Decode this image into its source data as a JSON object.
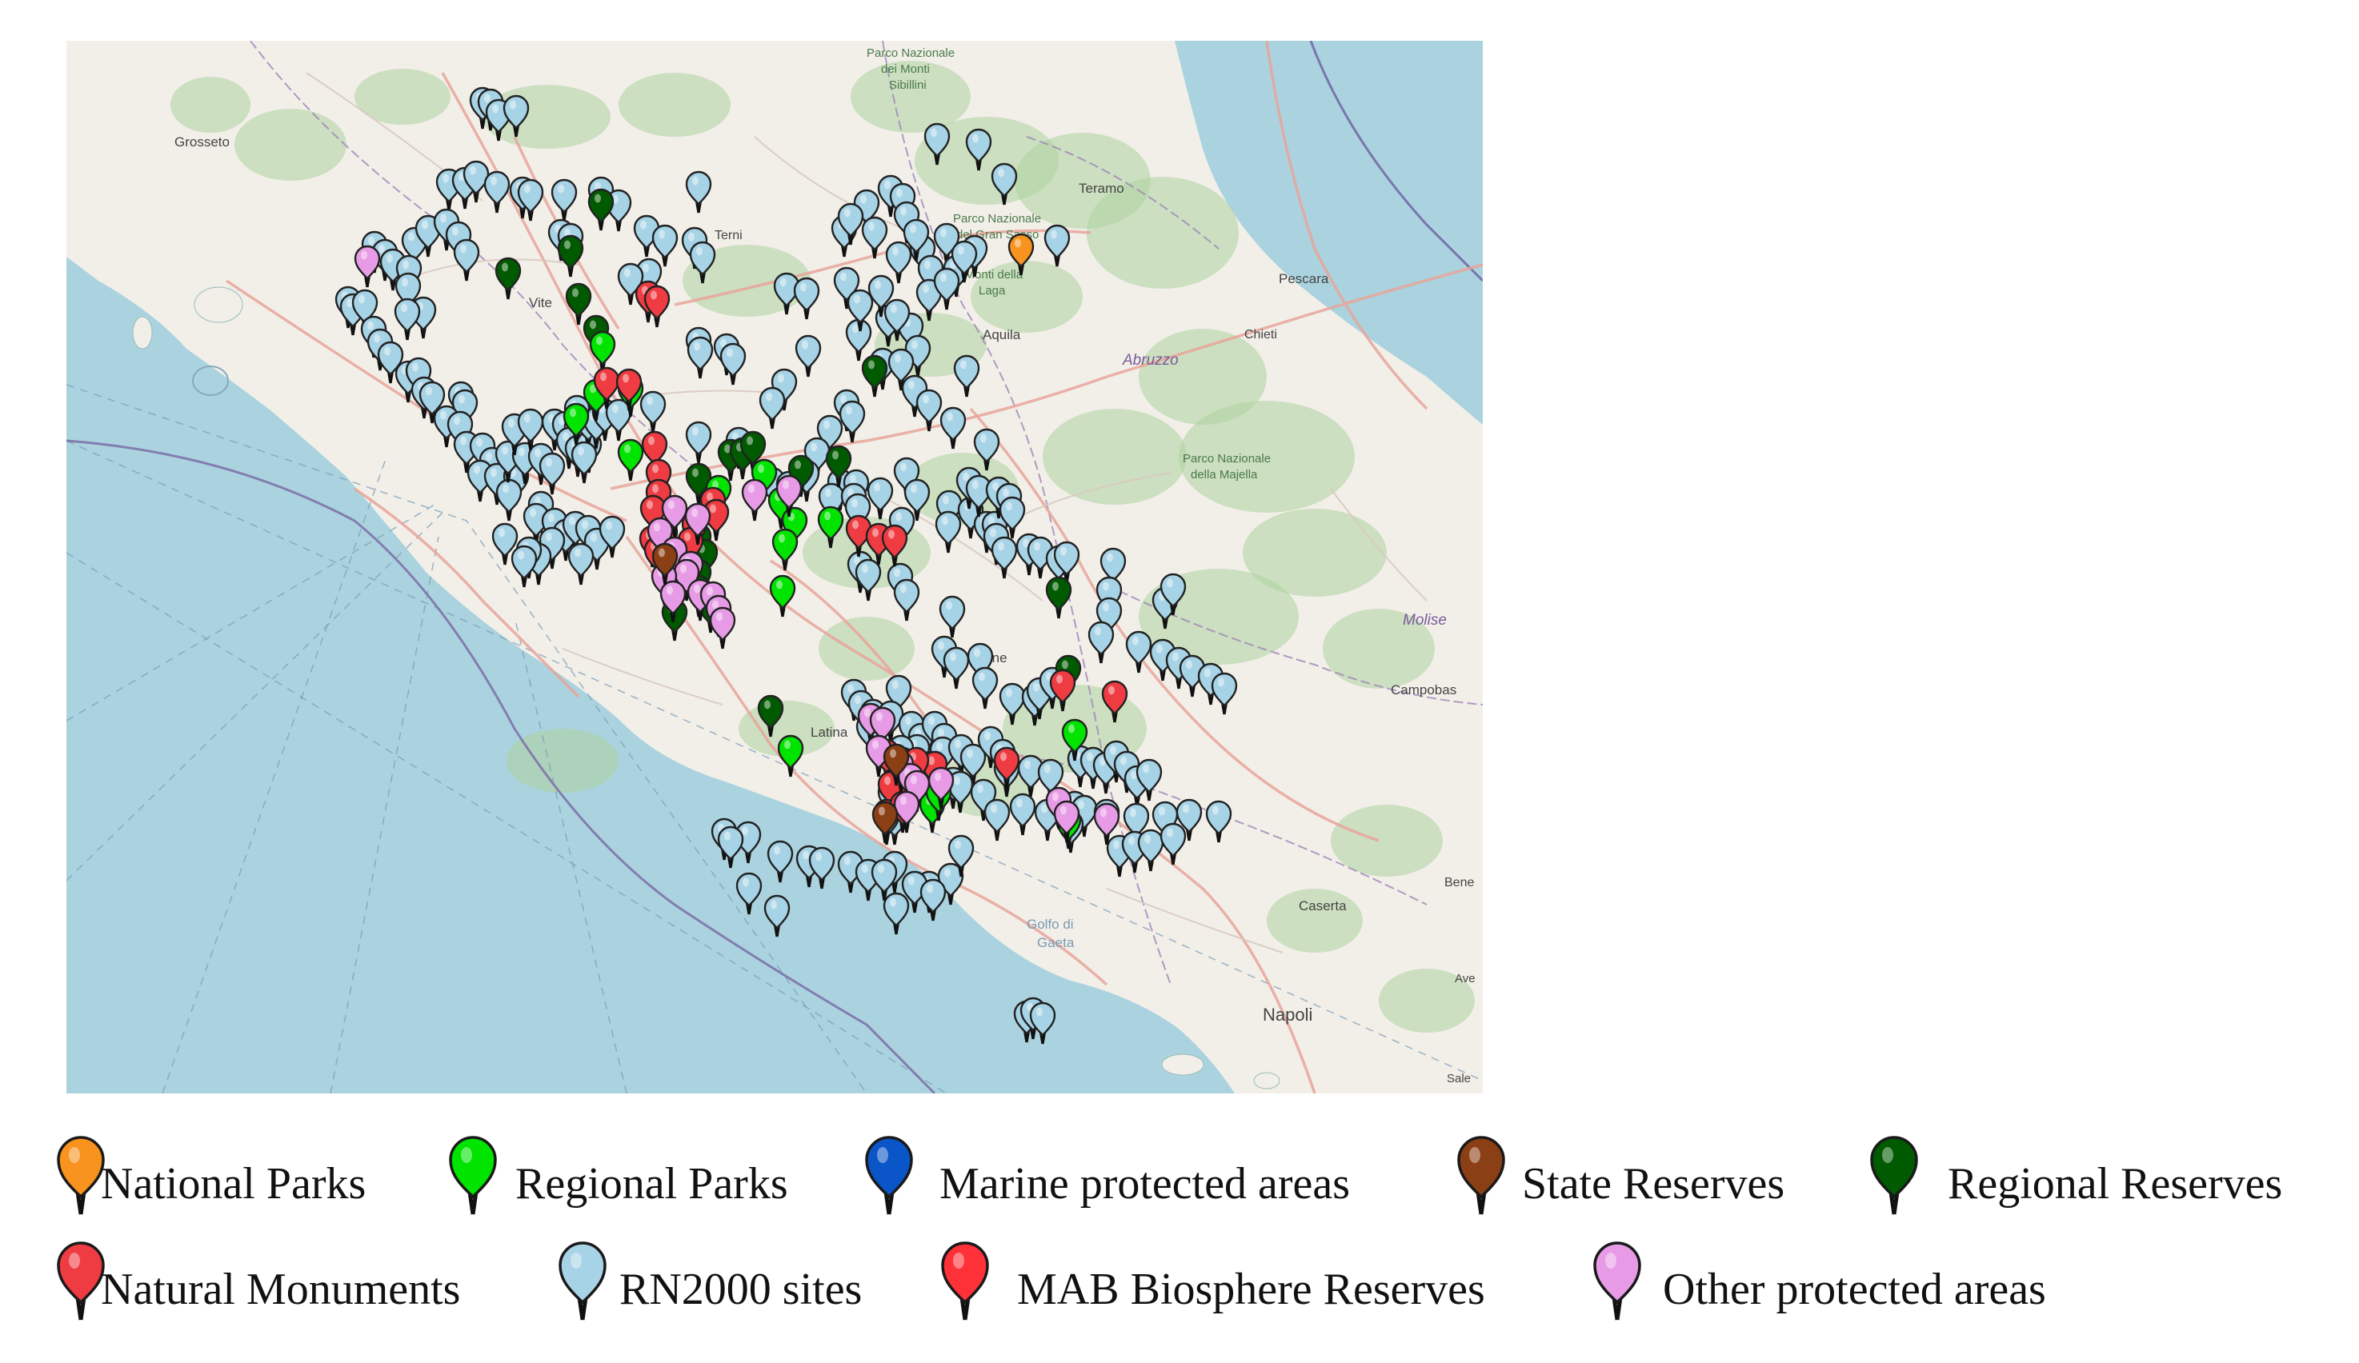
{
  "map": {
    "place_labels": [
      {
        "id": "grosseto",
        "text": "Grosseto"
      },
      {
        "id": "teramo",
        "text": "Teramo"
      },
      {
        "id": "pescara",
        "text": "Pescara"
      },
      {
        "id": "chieti",
        "text": "Chieti"
      },
      {
        "id": "laquila",
        "text": "Aquila"
      },
      {
        "id": "abruzzo",
        "text": "Abruzzo"
      },
      {
        "id": "frosinone",
        "text": "Frosinone"
      },
      {
        "id": "latina",
        "text": "Latina"
      },
      {
        "id": "campobasso",
        "text": "Campobas"
      },
      {
        "id": "molise",
        "text": "Molise"
      },
      {
        "id": "caserta",
        "text": "Caserta"
      },
      {
        "id": "napoli",
        "text": "Napoli"
      },
      {
        "id": "golfo",
        "text": "Golfo di"
      },
      {
        "id": "gaeta",
        "text": "Gaeta"
      },
      {
        "id": "sibillini_1",
        "text": "Parco Nazionale"
      },
      {
        "id": "sibillini_2",
        "text": "dei Monti"
      },
      {
        "id": "sibillini_3",
        "text": "Sibillini"
      },
      {
        "id": "gransasso_1",
        "text": "Parco Nazionale"
      },
      {
        "id": "gransasso_2",
        "text": "del Gran Sasso"
      },
      {
        "id": "gransasso_3",
        "text": "e Monti della"
      },
      {
        "id": "gransasso_4",
        "text": "Laga"
      },
      {
        "id": "majella_1",
        "text": "Parco Nazionale"
      },
      {
        "id": "majella_2",
        "text": "della Majella"
      },
      {
        "id": "benev",
        "text": "Bene"
      },
      {
        "id": "terni",
        "text": "Terni"
      },
      {
        "id": "viterbo",
        "text": "Vite"
      },
      {
        "id": "avell",
        "text": "Ave"
      },
      {
        "id": "salerno",
        "text": "Sale"
      }
    ],
    "colors": {
      "sea": "#aad3df",
      "land": "#f2efe9",
      "forest": "#add19e",
      "road": "#e8a49a",
      "boundary": "#9e85b8",
      "grid": "#7a9cb5"
    }
  },
  "legend": {
    "row1": [
      {
        "key": "national_parks",
        "label": "National Parks",
        "color": "#f7931e",
        "icon": "map-pin-icon"
      },
      {
        "key": "regional_parks",
        "label": "Regional Parks",
        "color": "#00e400",
        "icon": "map-pin-icon"
      },
      {
        "key": "marine",
        "label": "Marine protected areas",
        "color": "#0a55c8",
        "icon": "map-pin-icon"
      },
      {
        "key": "state_reserves",
        "label": "State Reserves",
        "color": "#8b3f14",
        "icon": "map-pin-icon"
      },
      {
        "key": "regional_reserves",
        "label": "Regional Reserves",
        "color": "#005a00",
        "icon": "map-pin-icon"
      }
    ],
    "row2": [
      {
        "key": "natural_monuments",
        "label": "Natural Monuments",
        "color": "#ef3b42",
        "icon": "map-pin-icon"
      },
      {
        "key": "rn2000",
        "label": "RN2000 sites",
        "color": "#a7d3e6",
        "icon": "map-pin-icon"
      },
      {
        "key": "mab",
        "label": "MAB Biosphere Reserves",
        "color": "#ff3138",
        "icon": "map-pin-icon"
      },
      {
        "key": "other",
        "label": "Other protected areas",
        "color": "#e79be6",
        "icon": "map-pin-icon"
      }
    ]
  }
}
